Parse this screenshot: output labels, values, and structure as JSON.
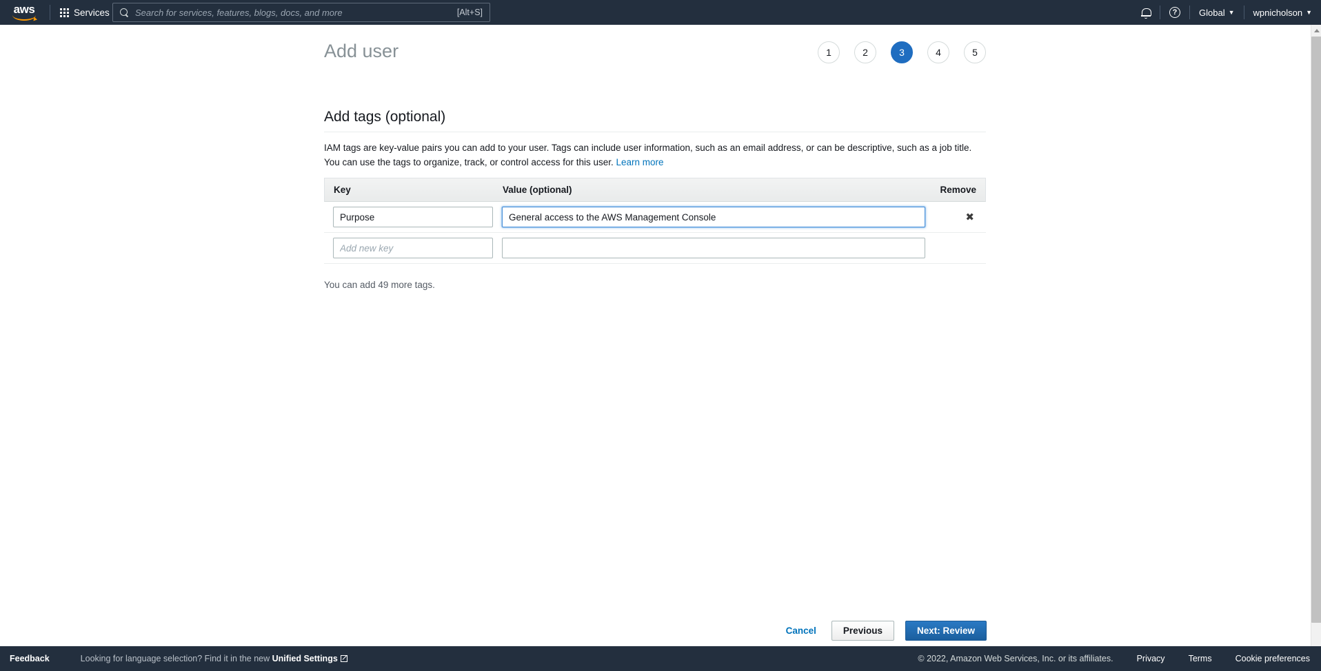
{
  "topnav": {
    "logo_text": "aws",
    "services_label": "Services",
    "search": {
      "placeholder": "Search for services, features, blogs, docs, and more",
      "shortcut": "[Alt+S]",
      "value": ""
    },
    "region_label": "Global",
    "account_label": "wpnicholson",
    "caret": "▼",
    "help_glyph": "?"
  },
  "page": {
    "title": "Add user",
    "steps": [
      {
        "label": "1",
        "active": false
      },
      {
        "label": "2",
        "active": false
      },
      {
        "label": "3",
        "active": true
      },
      {
        "label": "4",
        "active": false
      },
      {
        "label": "5",
        "active": false
      }
    ],
    "section_title": "Add tags (optional)",
    "description_part1": "IAM tags are key-value pairs you can add to your user. Tags can include user information, such as an email address, or can be descriptive, such as a job title. You can use the tags to organize, track, or control access for this user. ",
    "learn_more": "Learn more",
    "more_tags_note": "You can add 49 more tags."
  },
  "tags_table": {
    "headers": {
      "key": "Key",
      "value": "Value (optional)",
      "remove": "Remove"
    },
    "rows": [
      {
        "key_value": "Purpose",
        "key_placeholder": "",
        "value_value": "General access to the AWS Management Console",
        "value_placeholder": "",
        "value_focused": true,
        "remove_glyph": "✖",
        "has_remove": true
      },
      {
        "key_value": "",
        "key_placeholder": "Add new key",
        "value_value": "",
        "value_placeholder": "",
        "value_focused": false,
        "remove_glyph": "",
        "has_remove": false
      }
    ]
  },
  "actions": {
    "cancel": "Cancel",
    "previous": "Previous",
    "next": "Next: Review"
  },
  "footer": {
    "feedback": "Feedback",
    "language_prefix": "Looking for language selection? Find it in the new ",
    "language_link": "Unified Settings",
    "copyright": "© 2022, Amazon Web Services, Inc. or its affiliates.",
    "privacy": "Privacy",
    "terms": "Terms",
    "cookies": "Cookie preferences"
  },
  "colors": {
    "nav_bg": "#232f3e",
    "accent_blue": "#0073bb",
    "active_step": "#1f6dc0",
    "logo_orange": "#ff9900"
  }
}
